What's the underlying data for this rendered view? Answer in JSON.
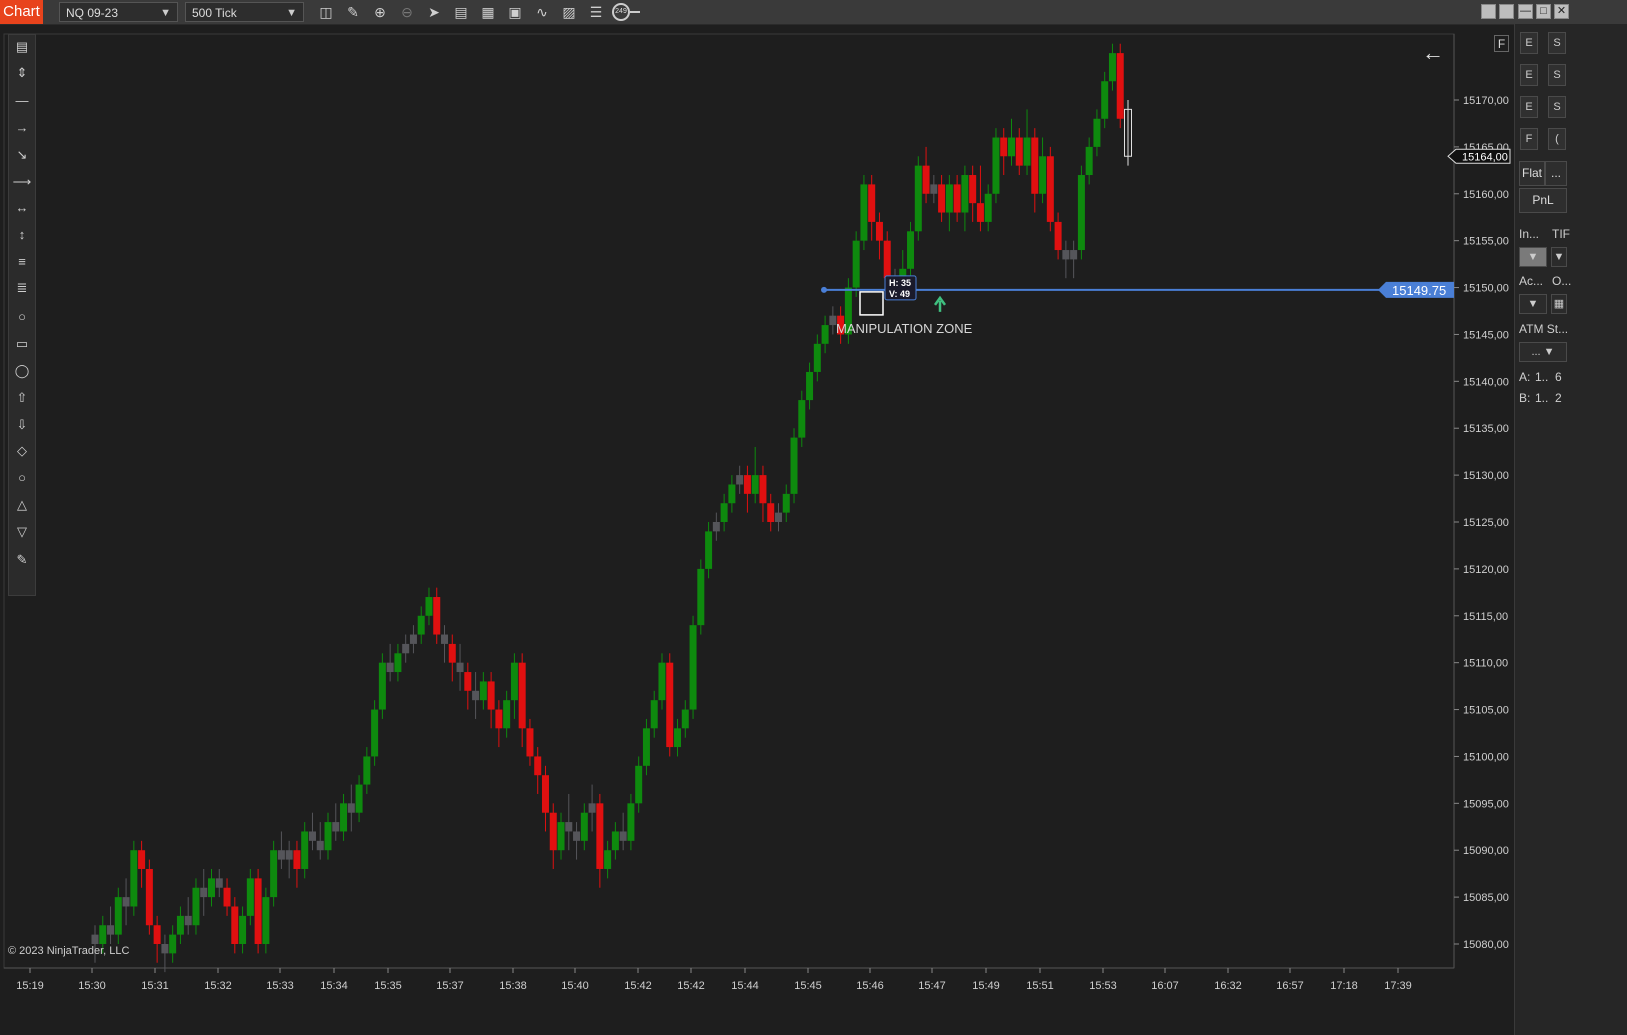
{
  "app": {
    "tab_label": "Chart",
    "instrument": "NQ 09-23",
    "interval": "500 Tick",
    "toolbar_badge": "249",
    "copyright": "© 2023 NinjaTrader, LLC",
    "f_button": "F"
  },
  "toolbar_icons": [
    "bars-icon",
    "pencil-icon",
    "zoom-in-icon",
    "zoom-out-icon",
    "pointer-icon",
    "data-box-icon",
    "template-icon",
    "properties-icon",
    "indicators-icon",
    "strategies-icon",
    "list-icon",
    "chart-trader-icon"
  ],
  "right_panel": {
    "quick_buttons": [
      "E",
      "S",
      "E",
      "S",
      "E",
      "S",
      "F",
      "("
    ],
    "position_label": "Flat",
    "position_more": "...",
    "pnl_label": "PnL",
    "instrument_label": "In...",
    "tif_label": "TIF",
    "account_label": "Ac...",
    "order_label": "O...",
    "atm_label": "ATM St...",
    "atm_value": "...",
    "ask_label": "A:",
    "ask_value": "1..",
    "ask_count": "6",
    "bid_label": "B:",
    "bid_value": "1..",
    "bid_count": "2"
  },
  "colors": {
    "up": "#0e8a0e",
    "down": "#e01010",
    "neutral": "#55555a",
    "line": "#4a7fd6",
    "background": "#1e1e1e"
  },
  "chart_data": {
    "type": "candlestick",
    "y_ticks": [
      "15170,00",
      "15165,00",
      "15160,00",
      "15155,00",
      "15150,00",
      "15145,00",
      "15140,00",
      "15135,00",
      "15130,00",
      "15125,00",
      "15120,00",
      "15115,00",
      "15110,00",
      "15105,00",
      "15100,00",
      "15095,00",
      "15090,00",
      "15085,00",
      "15080,00"
    ],
    "x_ticks": [
      "15:19",
      "15:30",
      "15:31",
      "15:32",
      "15:33",
      "15:34",
      "15:35",
      "15:37",
      "15:38",
      "15:40",
      "15:42",
      "15:42",
      "15:44",
      "15:45",
      "15:46",
      "15:47",
      "15:49",
      "15:51",
      "15:53",
      "16:07",
      "16:32",
      "16:57",
      "17:18",
      "17:39"
    ],
    "ylim": [
      15077,
      15178
    ],
    "last_price_label": "15164,00",
    "horizontal_line": {
      "price": 15149.75,
      "label": "15149.75"
    },
    "annotation": "MANIPULATION ZONE",
    "measure_tooltip": {
      "h": "H: 35",
      "v": "V: 49"
    },
    "candles": [
      [
        15081,
        15080,
        15082,
        15078
      ],
      [
        15080,
        15082,
        15083,
        15079
      ],
      [
        15082,
        15081,
        15084,
        15080
      ],
      [
        15081,
        15085,
        15086,
        15080
      ],
      [
        15085,
        15084,
        15087,
        15082
      ],
      [
        15084,
        15090,
        15091,
        15083
      ],
      [
        15090,
        15088,
        15091,
        15086
      ],
      [
        15088,
        15082,
        15089,
        15081
      ],
      [
        15082,
        15080,
        15083,
        15078
      ],
      [
        15080,
        15079,
        15081,
        15077
      ],
      [
        15079,
        15081,
        15082,
        15078
      ],
      [
        15081,
        15083,
        15084,
        15080
      ],
      [
        15083,
        15082,
        15085,
        15081
      ],
      [
        15082,
        15086,
        15087,
        15081
      ],
      [
        15086,
        15085,
        15088,
        15083
      ],
      [
        15085,
        15087,
        15088,
        15084
      ],
      [
        15087,
        15086,
        15088,
        15085
      ],
      [
        15086,
        15084,
        15087,
        15083
      ],
      [
        15084,
        15080,
        15085,
        15079
      ],
      [
        15080,
        15083,
        15084,
        15079
      ],
      [
        15083,
        15087,
        15088,
        15082
      ],
      [
        15087,
        15080,
        15088,
        15079
      ],
      [
        15080,
        15085,
        15086,
        15079
      ],
      [
        15085,
        15090,
        15091,
        15084
      ],
      [
        15090,
        15089,
        15092,
        15088
      ],
      [
        15089,
        15090,
        15091,
        15087
      ],
      [
        15090,
        15088,
        15091,
        15086
      ],
      [
        15088,
        15092,
        15093,
        15087
      ],
      [
        15092,
        15091,
        15094,
        15090
      ],
      [
        15091,
        15090,
        15093,
        15089
      ],
      [
        15090,
        15093,
        15094,
        15089
      ],
      [
        15093,
        15092,
        15095,
        15091
      ],
      [
        15092,
        15095,
        15096,
        15091
      ],
      [
        15095,
        15094,
        15097,
        15092
      ],
      [
        15094,
        15097,
        15098,
        15093
      ],
      [
        15097,
        15100,
        15101,
        15096
      ],
      [
        15100,
        15105,
        15106,
        15099
      ],
      [
        15105,
        15110,
        15111,
        15104
      ],
      [
        15110,
        15109,
        15112,
        15108
      ],
      [
        15109,
        15111,
        15112,
        15108
      ],
      [
        15111,
        15112,
        15113,
        15110
      ],
      [
        15112,
        15113,
        15114,
        15111
      ],
      [
        15113,
        15115,
        15116,
        15112
      ],
      [
        15115,
        15117,
        15118,
        15114
      ],
      [
        15117,
        15113,
        15118,
        15112
      ],
      [
        15113,
        15112,
        15114,
        15110
      ],
      [
        15112,
        15110,
        15113,
        15108
      ],
      [
        15110,
        15109,
        15112,
        15107
      ],
      [
        15109,
        15107,
        15110,
        15105
      ],
      [
        15107,
        15106,
        15109,
        15104
      ],
      [
        15106,
        15108,
        15109,
        15105
      ],
      [
        15108,
        15105,
        15109,
        15103
      ],
      [
        15105,
        15103,
        15106,
        15101
      ],
      [
        15103,
        15106,
        15107,
        15102
      ],
      [
        15106,
        15110,
        15111,
        15104
      ],
      [
        15110,
        15103,
        15111,
        15101
      ],
      [
        15103,
        15100,
        15104,
        15099
      ],
      [
        15100,
        15098,
        15101,
        15096
      ],
      [
        15098,
        15094,
        15099,
        15092
      ],
      [
        15094,
        15090,
        15095,
        15088
      ],
      [
        15090,
        15093,
        15094,
        15089
      ],
      [
        15093,
        15092,
        15096,
        15090
      ],
      [
        15092,
        15091,
        15093,
        15089
      ],
      [
        15091,
        15094,
        15095,
        15090
      ],
      [
        15094,
        15095,
        15097,
        15092
      ],
      [
        15095,
        15088,
        15096,
        15086
      ],
      [
        15088,
        15090,
        15091,
        15087
      ],
      [
        15090,
        15092,
        15093,
        15089
      ],
      [
        15092,
        15091,
        15094,
        15090
      ],
      [
        15091,
        15095,
        15096,
        15090
      ],
      [
        15095,
        15099,
        15100,
        15094
      ],
      [
        15099,
        15103,
        15104,
        15098
      ],
      [
        15103,
        15106,
        15107,
        15102
      ],
      [
        15106,
        15110,
        15111,
        15105
      ],
      [
        15110,
        15101,
        15111,
        15100
      ],
      [
        15101,
        15103,
        15104,
        15100
      ],
      [
        15103,
        15105,
        15106,
        15102
      ],
      [
        15105,
        15114,
        15115,
        15104
      ],
      [
        15114,
        15120,
        15121,
        15113
      ],
      [
        15120,
        15124,
        15125,
        15119
      ],
      [
        15124,
        15125,
        15126,
        15123
      ],
      [
        15125,
        15127,
        15128,
        15124
      ],
      [
        15127,
        15129,
        15130,
        15126
      ],
      [
        15129,
        15130,
        15131,
        15128
      ],
      [
        15130,
        15128,
        15131,
        15126
      ],
      [
        15128,
        15130,
        15133,
        15127
      ],
      [
        15130,
        15127,
        15131,
        15125
      ],
      [
        15127,
        15125,
        15128,
        15124
      ],
      [
        15125,
        15126,
        15127,
        15124
      ],
      [
        15126,
        15128,
        15129,
        15125
      ],
      [
        15128,
        15134,
        15135,
        15127
      ],
      [
        15134,
        15138,
        15139,
        15133
      ],
      [
        15138,
        15141,
        15142,
        15137
      ],
      [
        15141,
        15144,
        15145,
        15140
      ],
      [
        15144,
        15146,
        15147,
        15143
      ],
      [
        15146,
        15147,
        15148,
        15145
      ],
      [
        15147,
        15145,
        15148,
        15144
      ],
      [
        15145,
        15150,
        15151,
        15144
      ],
      [
        15150,
        15155,
        15156,
        15149
      ],
      [
        15155,
        15161,
        15162,
        15154
      ],
      [
        15161,
        15157,
        15162,
        15155
      ],
      [
        15157,
        15155,
        15158,
        15153
      ],
      [
        15155,
        15151,
        15156,
        15150
      ],
      [
        15151,
        15150,
        15152,
        15149
      ],
      [
        15150,
        15152,
        15154,
        15149
      ],
      [
        15152,
        15156,
        15157,
        15151
      ],
      [
        15156,
        15163,
        15164,
        15155
      ],
      [
        15163,
        15160,
        15165,
        15159
      ],
      [
        15160,
        15161,
        15162,
        15159
      ],
      [
        15161,
        15158,
        15162,
        15157
      ],
      [
        15158,
        15161,
        15162,
        15156
      ],
      [
        15161,
        15158,
        15162,
        15157
      ],
      [
        15158,
        15162,
        15163,
        15156
      ],
      [
        15162,
        15159,
        15163,
        15157
      ],
      [
        15159,
        15157,
        15163,
        15156
      ],
      [
        15157,
        15160,
        15161,
        15156
      ],
      [
        15160,
        15166,
        15167,
        15159
      ],
      [
        15166,
        15164,
        15167,
        15162
      ],
      [
        15164,
        15166,
        15168,
        15163
      ],
      [
        15166,
        15163,
        15167,
        15162
      ],
      [
        15163,
        15166,
        15169,
        15162
      ],
      [
        15166,
        15160,
        15167,
        15158
      ],
      [
        15160,
        15164,
        15166,
        15159
      ],
      [
        15164,
        15157,
        15165,
        15156
      ],
      [
        15157,
        15154,
        15158,
        15153
      ],
      [
        15154,
        15153,
        15155,
        15151
      ],
      [
        15153,
        15154,
        15155,
        15151
      ],
      [
        15154,
        15162,
        15163,
        15153
      ],
      [
        15162,
        15165,
        15166,
        15161
      ],
      [
        15165,
        15168,
        15169,
        15164
      ],
      [
        15168,
        15172,
        15173,
        15167
      ],
      [
        15172,
        15175,
        15176,
        15171
      ],
      [
        15175,
        15168,
        15176,
        15167
      ],
      [
        15164,
        15169,
        15170,
        15163
      ]
    ]
  }
}
